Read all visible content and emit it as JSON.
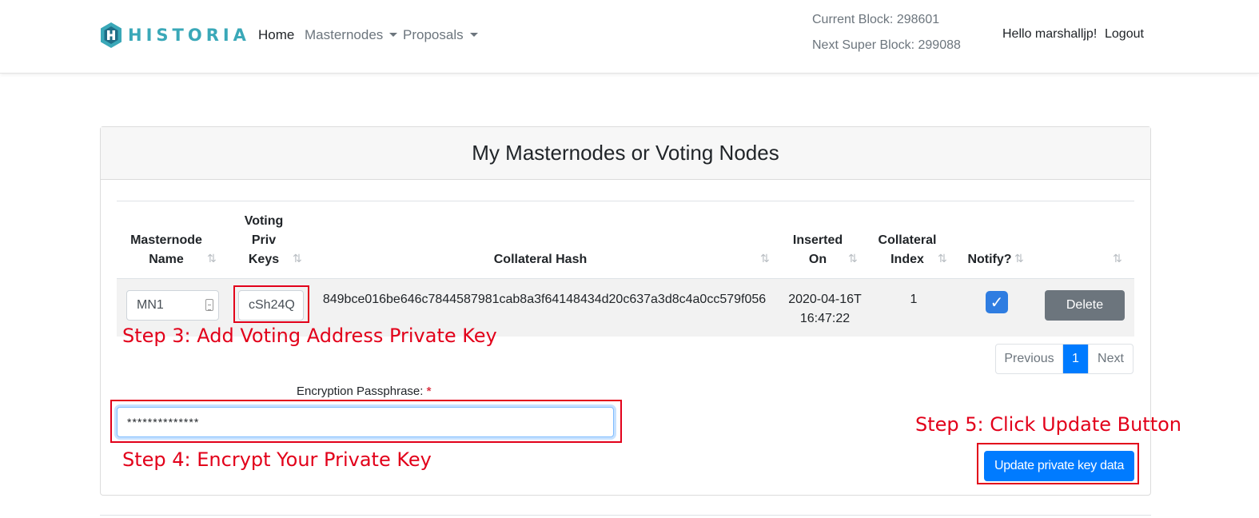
{
  "navbar": {
    "brand": "HISTORIA",
    "links": {
      "home": "Home",
      "masternodes": "Masternodes",
      "proposals": "Proposals"
    },
    "current_block": "Current Block: 298601",
    "next_super_block": "Next Super Block: 299088",
    "greeting": "Hello marshalljp!",
    "logout": "Logout"
  },
  "card": {
    "title": "My Masternodes or Voting Nodes",
    "headers": {
      "masternode_name": "Masternode Name",
      "voting_priv_keys": "Voting Priv Keys",
      "collateral_hash": "Collateral Hash",
      "inserted_on": "Inserted On",
      "collateral_index": "Collateral Index",
      "notify": "Notify?"
    },
    "row": {
      "name": "MN1",
      "voting_key": "cSh24Q",
      "collateral_hash": "849bce016be646c7844587981cab8a3f64148434d20c637a3d8c4a0cc579f056",
      "inserted_on": "2020-04-16T16:47:22",
      "collateral_index": "1",
      "notify": true,
      "delete_label": "Delete"
    },
    "pagination": {
      "previous": "Previous",
      "current": "1",
      "next": "Next"
    },
    "passphrase": {
      "label": "Encryption Passphrase:",
      "required_mark": "*",
      "value": "**************"
    },
    "update_button": "Update private key data"
  },
  "annotations": {
    "step3": "Step 3: Add Voting Address Private Key",
    "step4": "Step 4: Encrypt Your Private Key",
    "step5": "Step 5: Click Update Button",
    "color": "#e2001a"
  },
  "colors": {
    "brand": "#3aa8b8",
    "primary": "#007bff",
    "secondary": "#6c757d",
    "checkbox": "#2f7de1"
  }
}
